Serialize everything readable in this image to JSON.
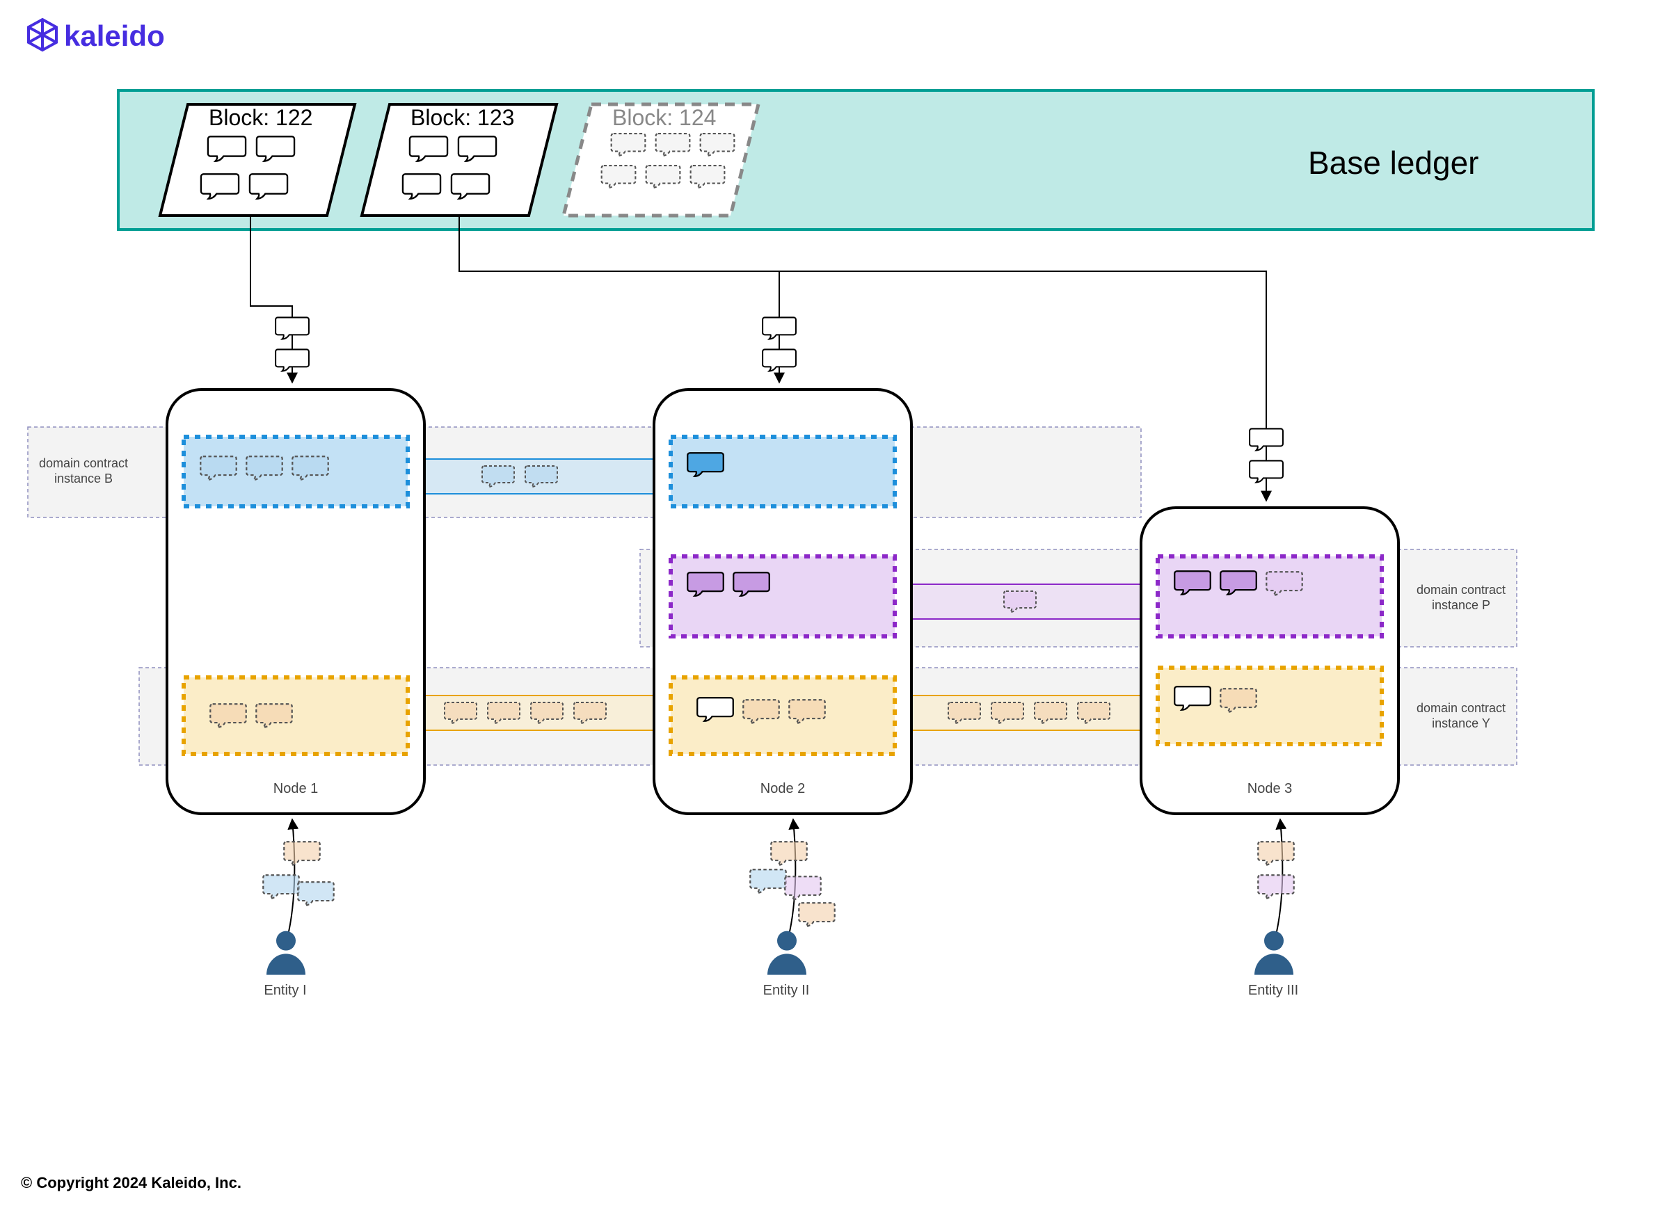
{
  "brand": "kaleido",
  "copyright": "© Copyright 2024 Kaleido, Inc.",
  "base_ledger_title": "Base ledger",
  "blocks": {
    "b122": "Block: 122",
    "b123": "Block: 123",
    "b124": "Block: 124"
  },
  "nodes": {
    "n1": "Node 1",
    "n2": "Node 2",
    "n3": "Node 3"
  },
  "entities": {
    "e1": "Entity I",
    "e2": "Entity II",
    "e3": "Entity III"
  },
  "domain_contracts": {
    "b": {
      "l1": "domain contract",
      "l2": "instance B"
    },
    "p": {
      "l1": "domain contract",
      "l2": "instance P"
    },
    "y": {
      "l1": "domain contract",
      "l2": "instance Y"
    }
  },
  "colors": {
    "teal": "#009e94",
    "teal_fill": "#bfeae6",
    "blue": "#1d8fdb",
    "blue_fill": "#c3e1f5",
    "purple": "#8c28c8",
    "purple_fill": "#e9d6f5",
    "amber": "#e8a300",
    "amber_fill": "#fbedc8",
    "amber_chip": "#f3d1ab",
    "blue_chip": "#b3d6ef",
    "purple_chip": "#e2c6f0",
    "lane_bg": "#f3f3f3",
    "lane_border": "#8f8fbf"
  }
}
